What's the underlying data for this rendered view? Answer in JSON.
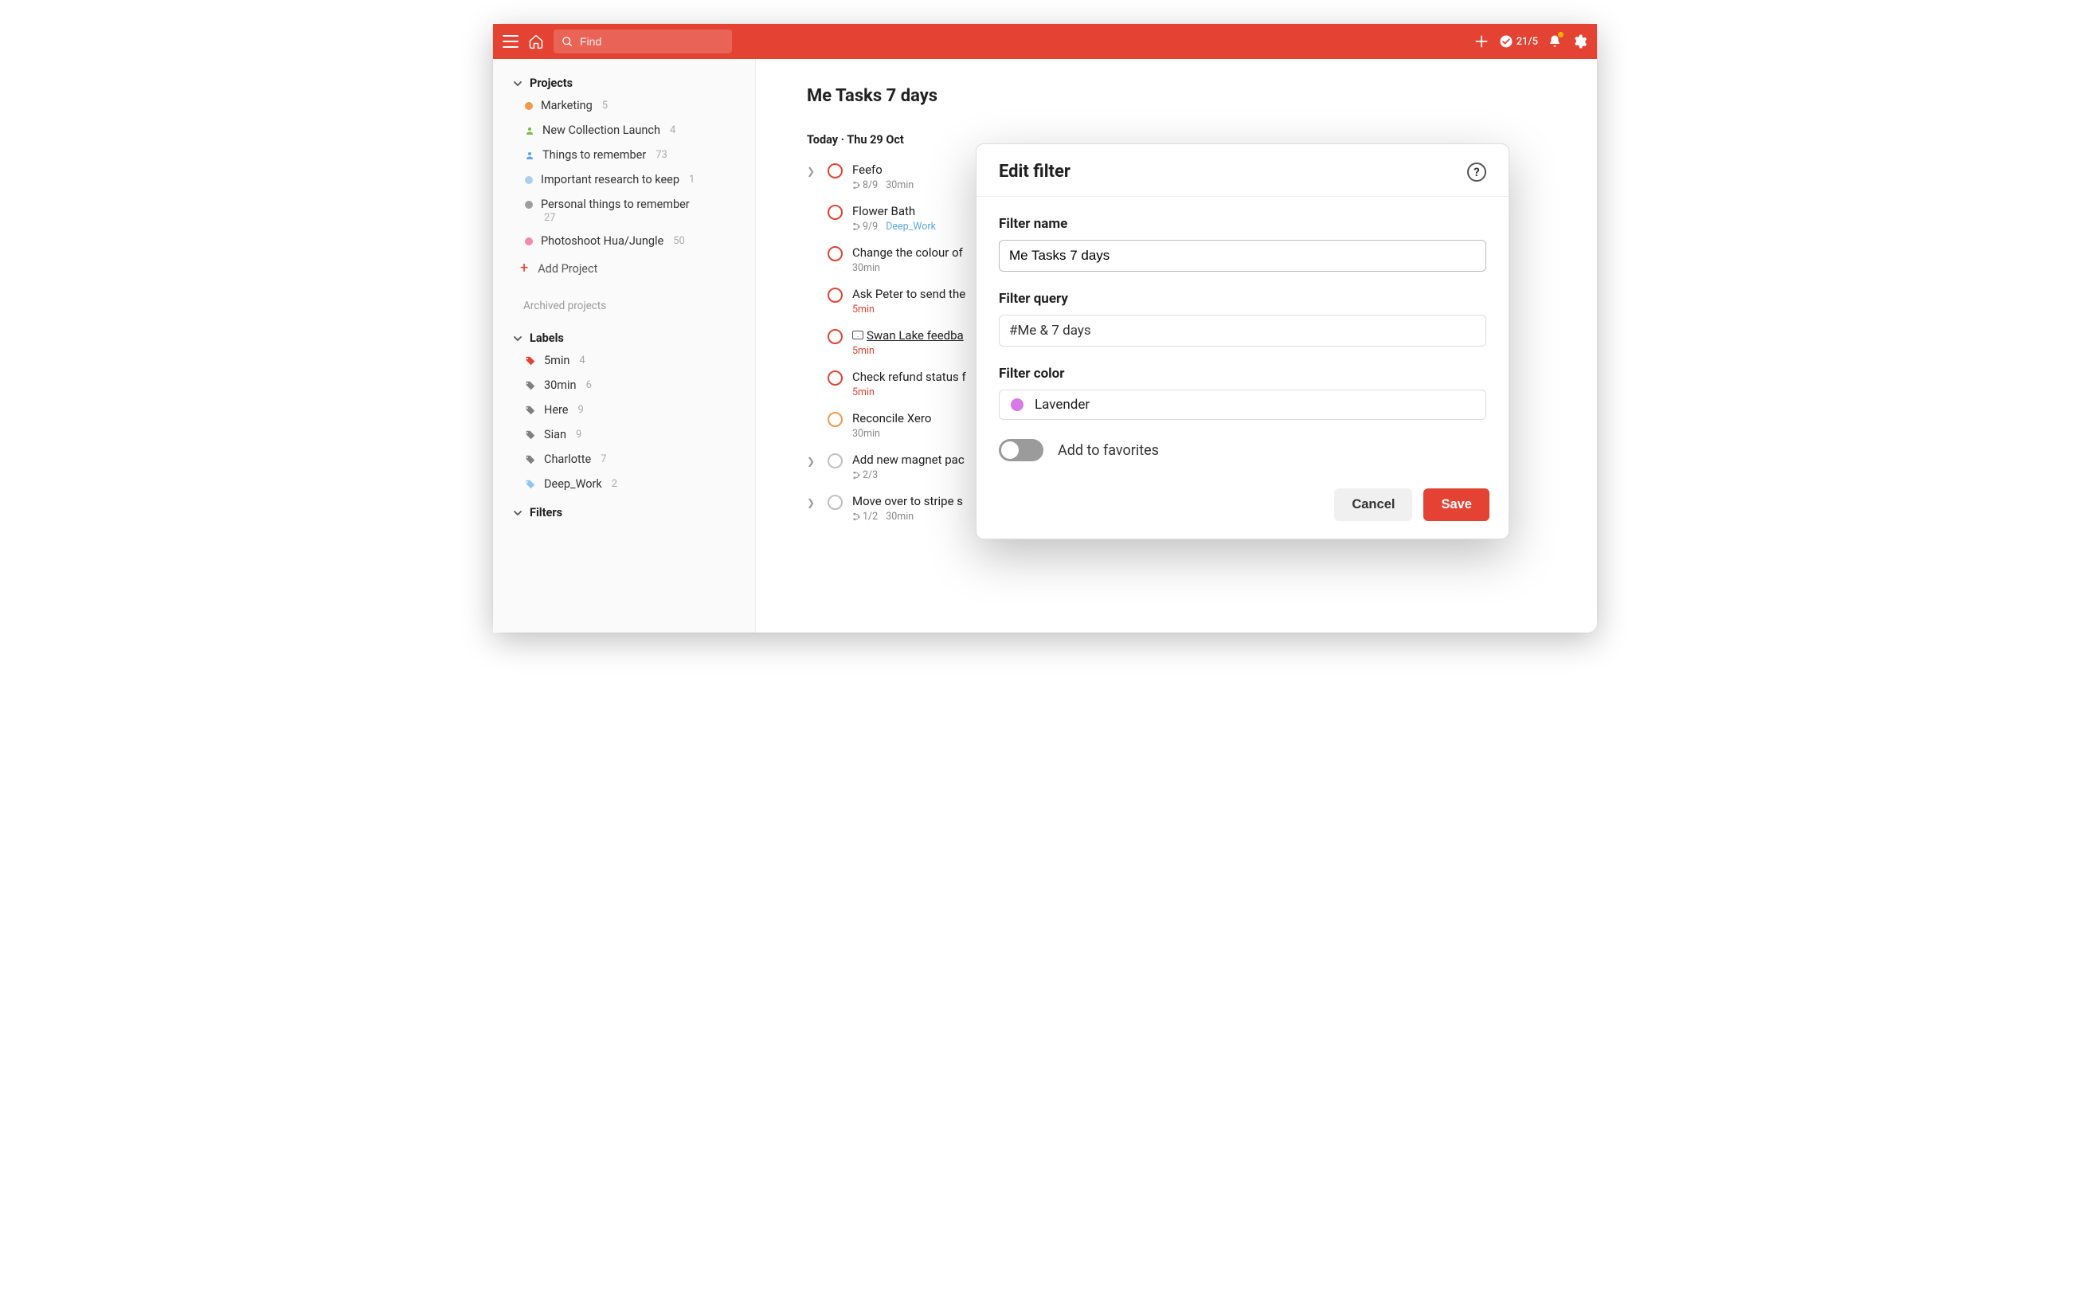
{
  "topbar": {
    "search_placeholder": "Find",
    "karma": "21/5"
  },
  "sidebar": {
    "projects_label": "Projects",
    "projects": [
      {
        "name": "Marketing",
        "count": "5",
        "color": "#f2994a",
        "kind": "dot"
      },
      {
        "name": "New Collection Launch",
        "count": "4",
        "color": "#7ab94d",
        "kind": "person"
      },
      {
        "name": "Things to remember",
        "count": "73",
        "color": "#5aa7e6",
        "kind": "person"
      },
      {
        "name": "Important research to keep",
        "count": "1",
        "color": "#a8cef0",
        "kind": "dot"
      },
      {
        "name": "Personal things to remember",
        "count": "",
        "sub": "27",
        "color": "#9e9e9e",
        "kind": "dot"
      },
      {
        "name": "Photoshoot Hua/Jungle",
        "count": "50",
        "color": "#f28aa5",
        "kind": "dot"
      }
    ],
    "add_project": "Add Project",
    "archived": "Archived projects",
    "labels_label": "Labels",
    "labels": [
      {
        "name": "5min",
        "count": "4",
        "color": "#e44232"
      },
      {
        "name": "30min",
        "count": "6",
        "color": "#808080"
      },
      {
        "name": "Here",
        "count": "9",
        "color": "#808080"
      },
      {
        "name": "Sian",
        "count": "9",
        "color": "#808080"
      },
      {
        "name": "Charlotte",
        "count": "7",
        "color": "#808080"
      },
      {
        "name": "Deep_Work",
        "count": "2",
        "color": "#8fc9f0"
      }
    ],
    "filters_label": "Filters"
  },
  "main": {
    "title": "Me Tasks 7 days",
    "date_header": "Today · Thu 29 Oct",
    "tasks": [
      {
        "title": "Feefo",
        "priority": "red",
        "expand": true,
        "sub": "8/9",
        "subtext": "30min",
        "subclass": ""
      },
      {
        "title": "Flower Bath",
        "priority": "red",
        "expand": false,
        "sub": "9/9",
        "subtext": "Deep_Work",
        "subclass": "meta-blue"
      },
      {
        "title": "Change the colour of",
        "priority": "red",
        "expand": false,
        "sub": "",
        "subtext": "30min",
        "subclass": ""
      },
      {
        "title": "Ask Peter to send the",
        "priority": "red",
        "expand": false,
        "sub": "",
        "subtext": "5min",
        "subclass": "meta-red"
      },
      {
        "title": "Swan Lake feedba",
        "priority": "red",
        "expand": false,
        "sub": "",
        "subtext": "5min",
        "subclass": "meta-red",
        "mail": true,
        "underline": true
      },
      {
        "title": "Check refund status f",
        "priority": "red",
        "expand": false,
        "sub": "",
        "subtext": "5min",
        "subclass": "meta-red"
      },
      {
        "title": "Reconcile Xero",
        "priority": "orange",
        "expand": false,
        "sub": "",
        "subtext": "30min",
        "subclass": ""
      },
      {
        "title": "Add new magnet pac",
        "priority": "gray",
        "expand": true,
        "sub": "2/3",
        "subtext": "",
        "subclass": ""
      },
      {
        "title": "Move over to stripe s",
        "priority": "gray",
        "expand": true,
        "sub": "1/2",
        "subtext": "30min",
        "subclass": ""
      }
    ]
  },
  "modal": {
    "title": "Edit filter",
    "filter_name_label": "Filter name",
    "filter_name_value": "Me Tasks 7 days",
    "filter_query_label": "Filter query",
    "filter_query_value": "#Me & 7 days",
    "filter_color_label": "Filter color",
    "filter_color_name": "Lavender",
    "filter_color_hex": "#d678e8",
    "favorites_label": "Add to favorites",
    "cancel": "Cancel",
    "save": "Save"
  }
}
